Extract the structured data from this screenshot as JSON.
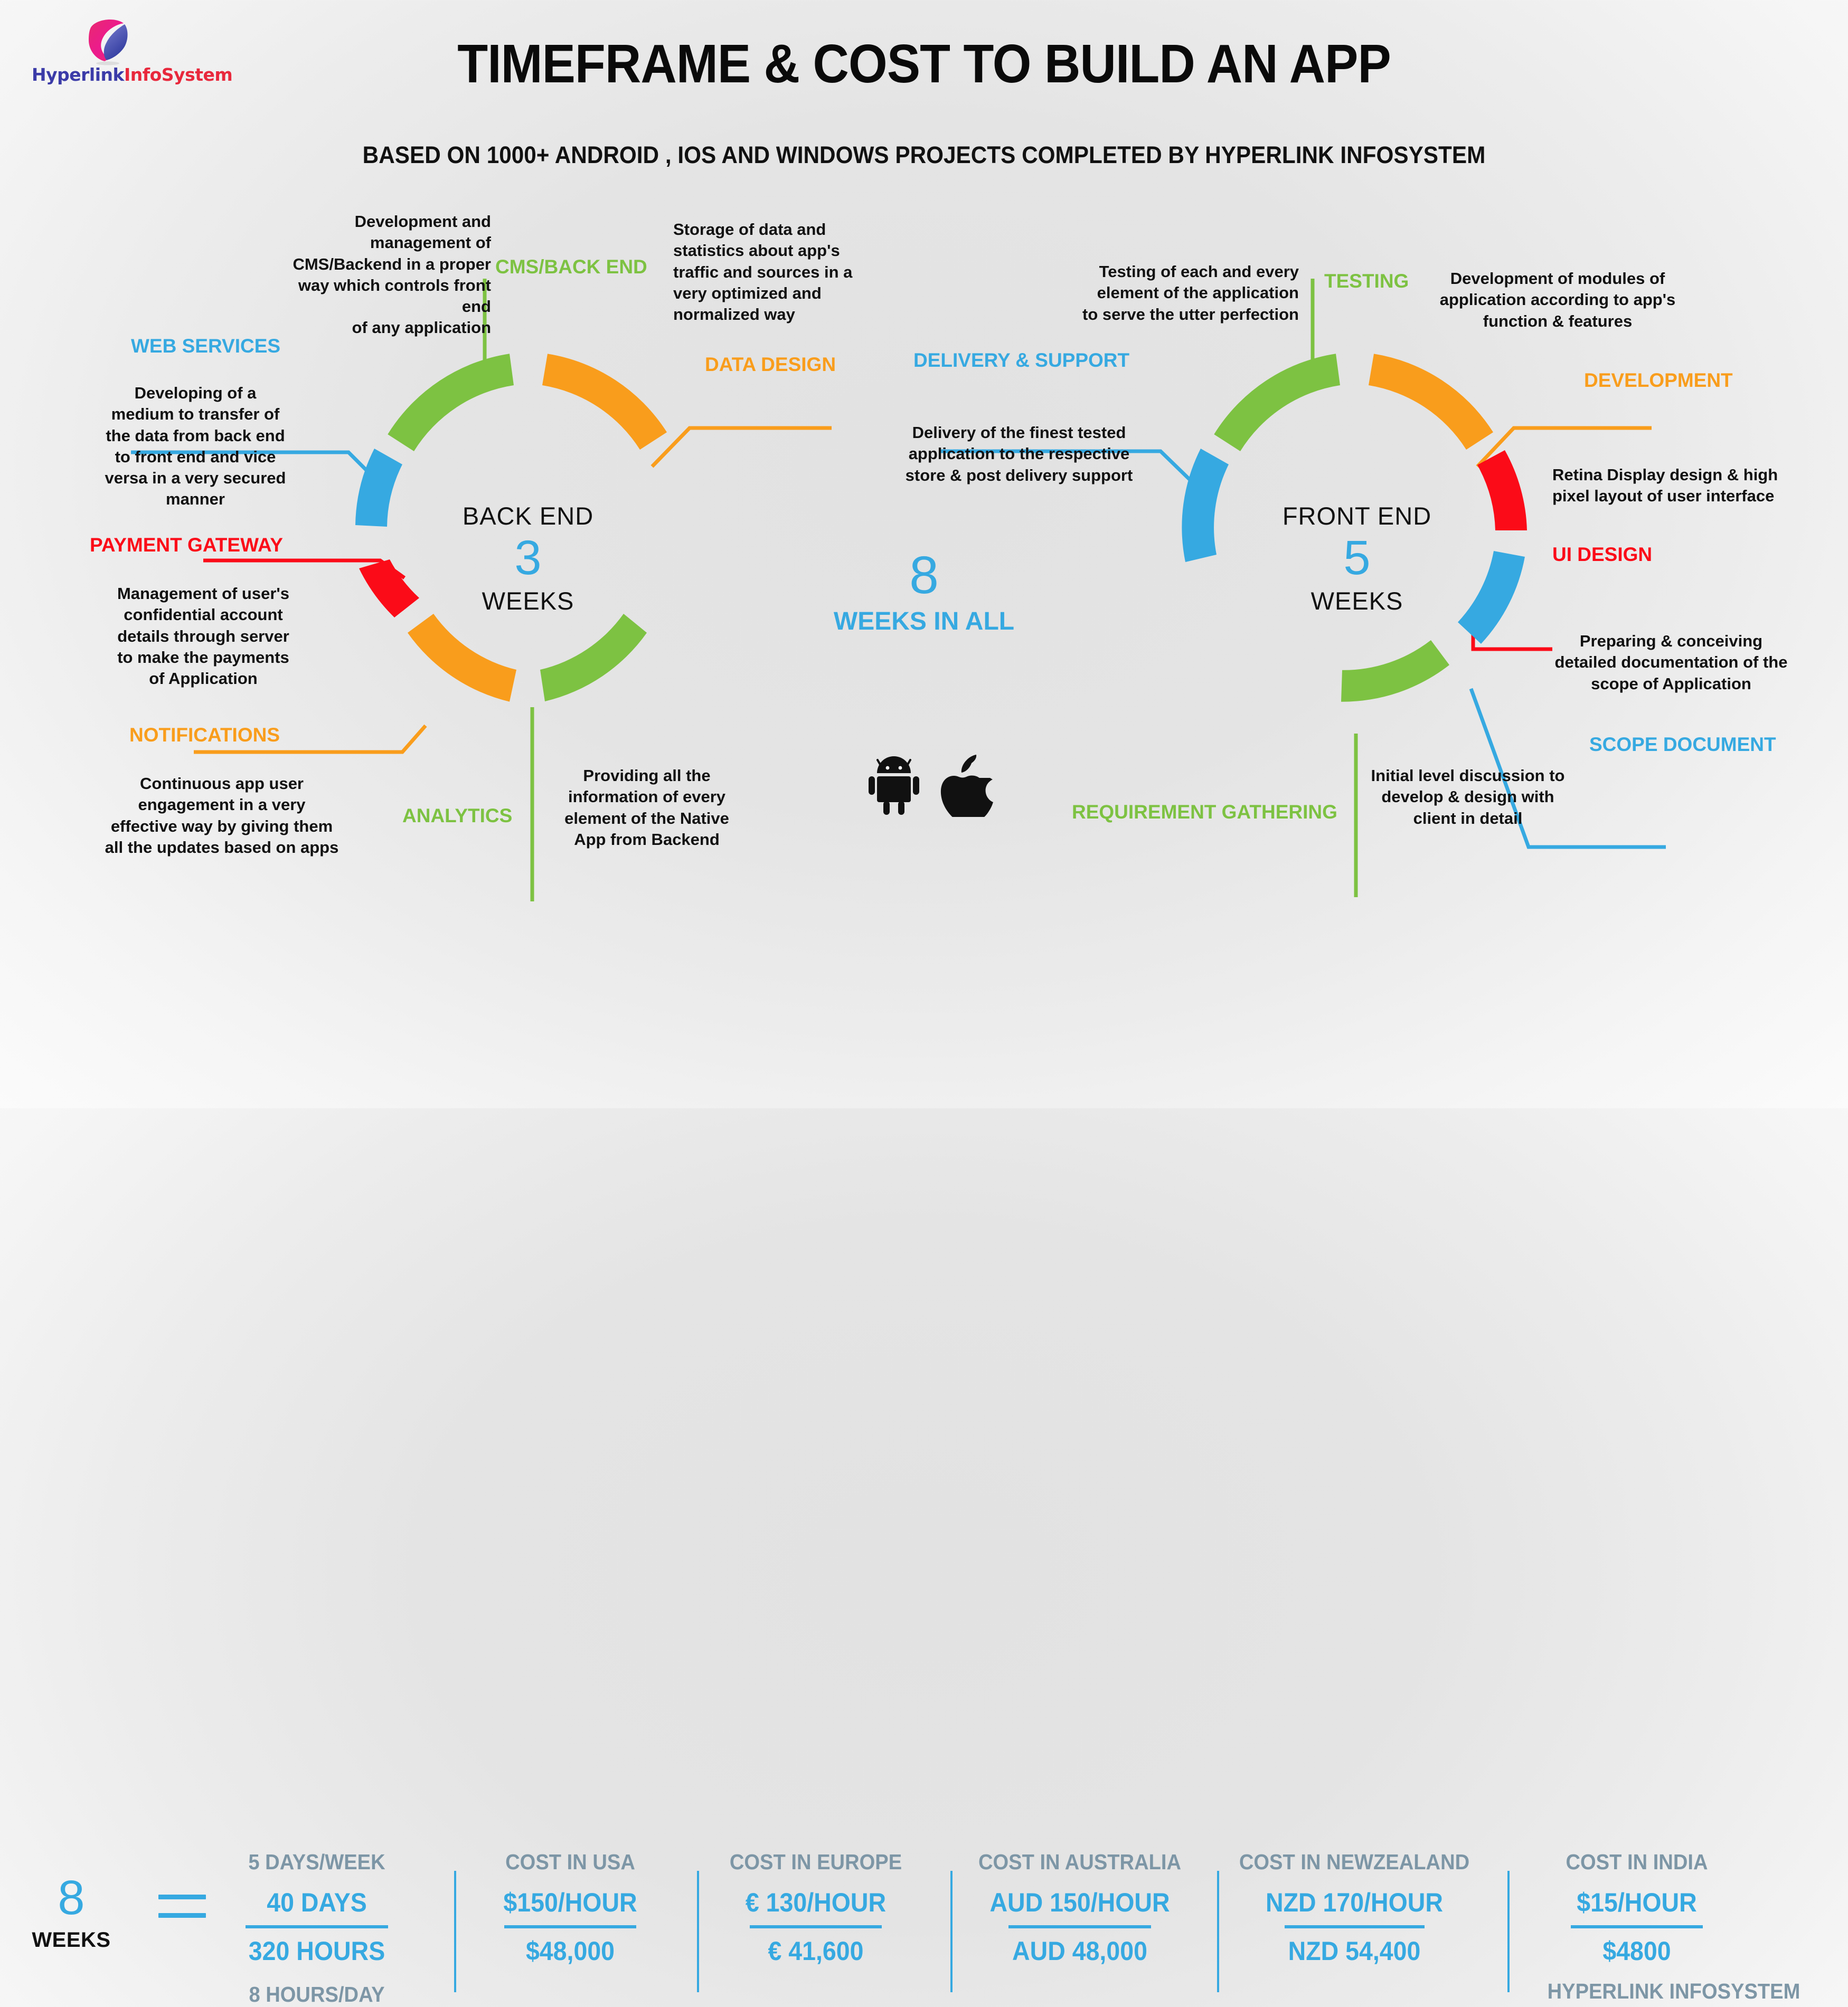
{
  "brand": {
    "name_part1": "Hyperlink",
    "name_part2": "InfoSystem",
    "footer": "HYPERLINK INFOSYSTEM"
  },
  "header": {
    "title": "TIMEFRAME & COST TO BUILD AN APP",
    "subtitle": "BASED ON 1000+ ANDROID , IOS AND WINDOWS PROJECTS COMPLETED BY HYPERLINK INFOSYSTEM"
  },
  "colors": {
    "green": "#7dc242",
    "orange": "#f99d1c",
    "blue": "#36a9e1",
    "red": "#fb0b18",
    "grey_text": "#7d96a6",
    "black": "#111111"
  },
  "backend": {
    "hub_title": "BACK END",
    "hub_number": "3",
    "hub_unit": "WEEKS",
    "segments": [
      {
        "label": "CMS/BACK END",
        "color": "#7dc242",
        "description": "Development and\nmanagement of\nCMS/Backend in a proper\nway which controls front end\nof any application"
      },
      {
        "label": "DATA DESIGN",
        "color": "#f99d1c",
        "description": "Storage of data and\nstatistics about app's\ntraffic and sources in a\nvery optimized and\nnormalized way"
      },
      {
        "label": "ANALYTICS",
        "color": "#7dc242",
        "description": "Providing all the\ninformation of every\nelement of the Native\nApp from Backend"
      },
      {
        "label": "NOTIFICATIONS",
        "color": "#f99d1c",
        "description": "Continuous app user\nengagement in a very\neffective way by giving them\nall the updates based on apps"
      },
      {
        "label": "PAYMENT GATEWAY",
        "color": "#fb0b18",
        "description": "Management of user's\nconfidential account\ndetails through server\nto make the payments\nof Application"
      },
      {
        "label": "WEB SERVICES",
        "color": "#36a9e1",
        "description": "Developing of a\nmedium to transfer of\nthe data from back end\nto front end and vice\nversa in a very secured\nmanner"
      }
    ]
  },
  "total": {
    "number": "8",
    "unit": "WEEKS IN ALL"
  },
  "platforms": [
    "android-icon",
    "apple-icon"
  ],
  "frontend": {
    "hub_title": "FRONT END",
    "hub_number": "5",
    "hub_unit": "WEEKS",
    "segments": [
      {
        "label": "TESTING",
        "color": "#7dc242",
        "description": "Testing of each and every\nelement of the application\nto serve the utter perfection"
      },
      {
        "label": "DEVELOPMENT",
        "color": "#f99d1c",
        "description": "Development of modules of\napplication according to app's\nfunction & features"
      },
      {
        "label": "UI DESIGN",
        "color": "#fb0b18",
        "description": "Retina Display design & high\npixel layout of user interface"
      },
      {
        "label": "SCOPE DOCUMENT",
        "color": "#36a9e1",
        "description": "Preparing & conceiving\ndetailed documentation of the\nscope of Application"
      },
      {
        "label": "REQUIREMENT GATHERING",
        "color": "#7dc242",
        "description": "Initial level discussion to\ndevelop & design with\nclient in detail"
      },
      {
        "label": "DELIVERY & SUPPORT",
        "color": "#36a9e1",
        "description": "Delivery of the finest tested\napplication to the respective\nstore & post delivery support"
      }
    ]
  },
  "footer": {
    "weeks_number": "8",
    "weeks_unit": "WEEKS",
    "columns": [
      {
        "head": "5 DAYS/WEEK",
        "value": "40 DAYS",
        "sub": "320 HOURS",
        "note": "8 HOURS/DAY"
      },
      {
        "head": "COST IN USA",
        "value": "$150/HOUR",
        "sub": "$48,000",
        "note": ""
      },
      {
        "head": "COST IN EUROPE",
        "value": "€ 130/HOUR",
        "sub": "€ 41,600",
        "note": ""
      },
      {
        "head": "COST IN AUSTRALIA",
        "value": "AUD 150/HOUR",
        "sub": "AUD 48,000",
        "note": ""
      },
      {
        "head": "COST IN NEWZEALAND",
        "value": "NZD 170/HOUR",
        "sub": "NZD 54,400",
        "note": ""
      },
      {
        "head": "COST IN INDIA",
        "value": "$15/HOUR",
        "sub": "$4800",
        "note": ""
      }
    ]
  }
}
